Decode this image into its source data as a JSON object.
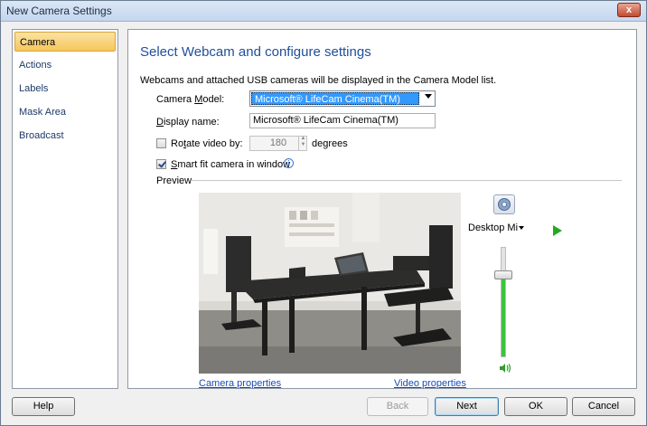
{
  "window": {
    "title": "New Camera Settings",
    "close_label": "x"
  },
  "sidebar": {
    "items": [
      {
        "label": "Camera",
        "active": true
      },
      {
        "label": "Actions"
      },
      {
        "label": "Labels"
      },
      {
        "label": "Mask Area"
      },
      {
        "label": "Broadcast"
      }
    ]
  },
  "panel": {
    "heading": "Select Webcam and configure settings",
    "description": "Webcams and attached USB cameras will be displayed in the Camera Model list.",
    "camera_model": {
      "label_pre": "Camera ",
      "label_key": "M",
      "label_post": "odel:",
      "value": "Microsoft® LifeCam Cinema(TM)"
    },
    "display_name": {
      "label_key": "D",
      "label_post": "isplay name:",
      "value": "Microsoft® LifeCam Cinema(TM)"
    },
    "rotate": {
      "label_pre": "Ro",
      "label_key": "t",
      "label_post": "ate video by:",
      "value": "180",
      "unit": "degrees",
      "checked": false
    },
    "smart_fit": {
      "label_key": "S",
      "label_post": "mart fit camera in window",
      "checked": true
    },
    "preview_label": "Preview",
    "camera_properties_link": "Camera properties",
    "video_properties_link": "Video properties",
    "audio_source": "Desktop Mi",
    "volume_level": 0.78
  },
  "buttons": {
    "help": "Help",
    "back": "Back",
    "next": "Next",
    "ok": "OK",
    "cancel": "Cancel"
  },
  "colors": {
    "accent": "#1f4e9a",
    "selection": "#3399ff",
    "active_tab": "#f5c65c",
    "play": "#22aa22",
    "volume": "#3cc43c"
  }
}
